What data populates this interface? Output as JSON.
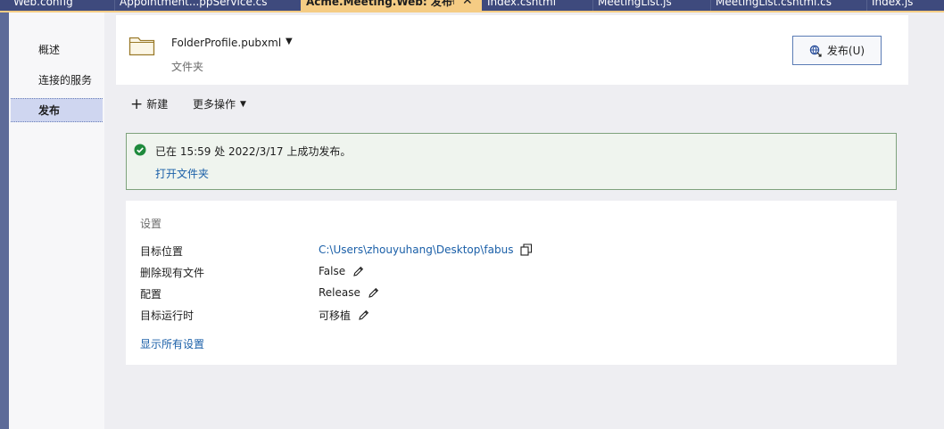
{
  "tabs": [
    {
      "label": "Web.config"
    },
    {
      "label": "Appointment...ppService.cs"
    },
    {
      "label": "Acme.Meeting.Web: 发布",
      "active": true
    },
    {
      "label": "Index.cshtml"
    },
    {
      "label": "MeetingList.js"
    },
    {
      "label": "MeetingList.cshtml.cs"
    },
    {
      "label": "Index.js"
    }
  ],
  "tab_icons": {
    "pin": "pin-icon",
    "close": "close-icon"
  },
  "nav": {
    "items": [
      {
        "label": "概述"
      },
      {
        "label": "连接的服务"
      },
      {
        "label": "发布",
        "selected": true
      }
    ]
  },
  "header": {
    "profile_name": "FolderProfile.pubxml",
    "profile_type": "文件夹",
    "publish_button": "发布(U)",
    "icon": "folder-icon"
  },
  "toolbar": {
    "new_label": "新建",
    "more_label": "更多操作"
  },
  "status": {
    "message": "已在 15:59 处 2022/3/17 上成功发布。",
    "open_folder": "打开文件夹",
    "color": "#1e8a3c"
  },
  "settings": {
    "title": "设置",
    "rows": [
      {
        "label": "目标位置",
        "value": "C:\\Users\\zhouyuhang\\Desktop\\fabus",
        "action": "copy-icon",
        "is_link": true
      },
      {
        "label": "删除现有文件",
        "value": "False",
        "action": "edit-icon"
      },
      {
        "label": "配置",
        "value": "Release",
        "action": "edit-icon"
      },
      {
        "label": "目标运行时",
        "value": "可移植",
        "action": "edit-icon"
      }
    ],
    "show_all": "显示所有设置"
  },
  "colors": {
    "tab_strip": "#3e4a7d",
    "active_tab": "#f5cc84",
    "link": "#1a5fa8",
    "success_border": "#7ea27c"
  }
}
